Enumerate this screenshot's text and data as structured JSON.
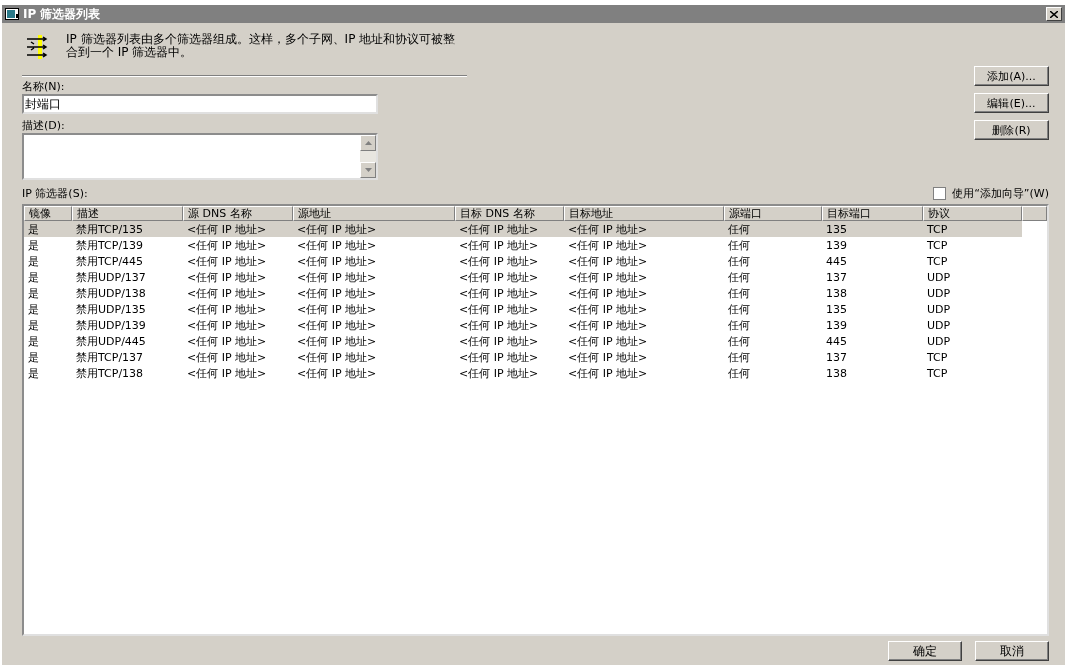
{
  "window": {
    "title": "IP 筛选器列表"
  },
  "intro": "IP 筛选器列表由多个筛选器组成。这样，多个子网、IP 地址和协议可被整合到一个 IP 筛选器中。",
  "name_field": {
    "label": "名称(N):",
    "value": "封端口"
  },
  "description_field": {
    "label": "描述(D):"
  },
  "side_buttons": [
    "添加(A)...",
    "编辑(E)...",
    "删除(R)"
  ],
  "filters_label": "IP 筛选器(S):",
  "wizard_checkbox": {
    "label": "使用“添加向导”(W)",
    "checked": false
  },
  "table": {
    "columns": [
      "镜像",
      "描述",
      "源 DNS 名称",
      "源地址",
      "目标 DNS 名称",
      "目标地址",
      "源端口",
      "目标端口",
      "协议"
    ],
    "rows": [
      {
        "selected": true,
        "cells": [
          "是",
          "禁用TCP/135",
          "<任何 IP 地址>",
          "<任何 IP 地址>",
          "<任何 IP 地址>",
          "<任何 IP 地址>",
          "任何",
          "135",
          "TCP"
        ]
      },
      {
        "selected": false,
        "cells": [
          "是",
          "禁用TCP/139",
          "<任何 IP 地址>",
          "<任何 IP 地址>",
          "<任何 IP 地址>",
          "<任何 IP 地址>",
          "任何",
          "139",
          "TCP"
        ]
      },
      {
        "selected": false,
        "cells": [
          "是",
          "禁用TCP/445",
          "<任何 IP 地址>",
          "<任何 IP 地址>",
          "<任何 IP 地址>",
          "<任何 IP 地址>",
          "任何",
          "445",
          "TCP"
        ]
      },
      {
        "selected": false,
        "cells": [
          "是",
          "禁用UDP/137",
          "<任何 IP 地址>",
          "<任何 IP 地址>",
          "<任何 IP 地址>",
          "<任何 IP 地址>",
          "任何",
          "137",
          "UDP"
        ]
      },
      {
        "selected": false,
        "cells": [
          "是",
          "禁用UDP/138",
          "<任何 IP 地址>",
          "<任何 IP 地址>",
          "<任何 IP 地址>",
          "<任何 IP 地址>",
          "任何",
          "138",
          "UDP"
        ]
      },
      {
        "selected": false,
        "cells": [
          "是",
          "禁用UDP/135",
          "<任何 IP 地址>",
          "<任何 IP 地址>",
          "<任何 IP 地址>",
          "<任何 IP 地址>",
          "任何",
          "135",
          "UDP"
        ]
      },
      {
        "selected": false,
        "cells": [
          "是",
          "禁用UDP/139",
          "<任何 IP 地址>",
          "<任何 IP 地址>",
          "<任何 IP 地址>",
          "<任何 IP 地址>",
          "任何",
          "139",
          "UDP"
        ]
      },
      {
        "selected": false,
        "cells": [
          "是",
          "禁用UDP/445",
          "<任何 IP 地址>",
          "<任何 IP 地址>",
          "<任何 IP 地址>",
          "<任何 IP 地址>",
          "任何",
          "445",
          "UDP"
        ]
      },
      {
        "selected": false,
        "cells": [
          "是",
          "禁用TCP/137",
          "<任何 IP 地址>",
          "<任何 IP 地址>",
          "<任何 IP 地址>",
          "<任何 IP 地址>",
          "任何",
          "137",
          "TCP"
        ]
      },
      {
        "selected": false,
        "cells": [
          "是",
          "禁用TCP/138",
          "<任何 IP 地址>",
          "<任何 IP 地址>",
          "<任何 IP 地址>",
          "<任何 IP 地址>",
          "任何",
          "138",
          "TCP"
        ]
      }
    ]
  },
  "footer_buttons": [
    "确定",
    "取消"
  ]
}
